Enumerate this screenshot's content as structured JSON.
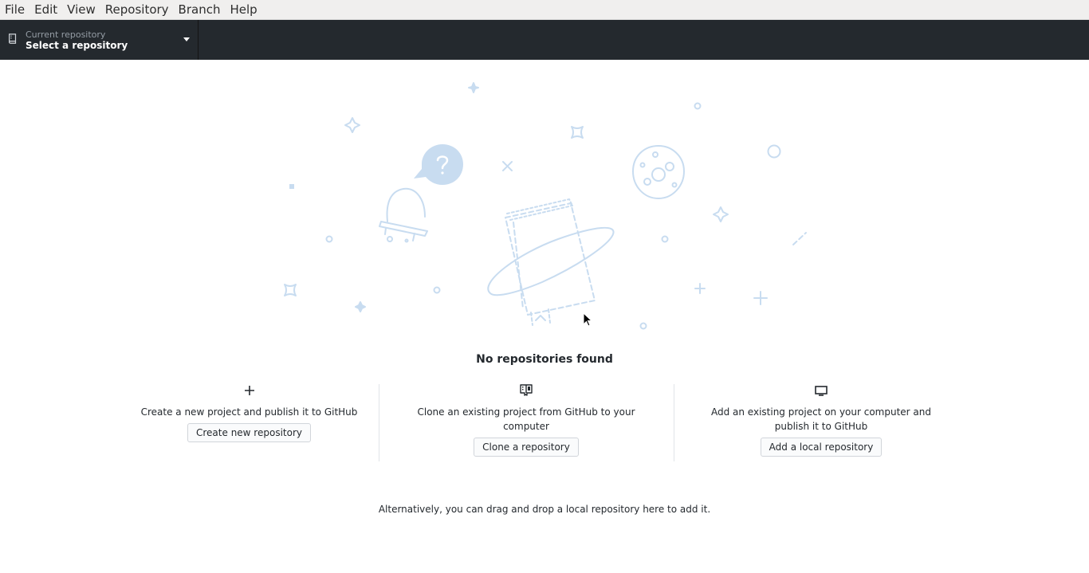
{
  "menu": {
    "items": [
      {
        "label": "File"
      },
      {
        "label": "Edit"
      },
      {
        "label": "View"
      },
      {
        "label": "Repository"
      },
      {
        "label": "Branch"
      },
      {
        "label": "Help"
      }
    ]
  },
  "toolbar": {
    "repository": {
      "caption": "Current repository",
      "value": "Select a repository",
      "icon": "repo-icon"
    }
  },
  "main": {
    "title": "No repositories found",
    "options": [
      {
        "icon": "plus-icon",
        "text": "Create a new project and publish it to GitHub",
        "button": "Create new repository"
      },
      {
        "icon": "repo-clone-icon",
        "text": "Clone an existing project from GitHub to your computer",
        "button": "Clone a repository"
      },
      {
        "icon": "device-desktop-icon",
        "text": "Add an existing project on your computer and publish it to GitHub",
        "button": "Add a local repository"
      }
    ],
    "drag_hint": "Alternatively, you can drag and drop a local repository here to add it."
  },
  "colors": {
    "toolbar_bg": "#24292e",
    "illustration": "#c8dcf0",
    "menubar_bg": "#f0efee"
  }
}
